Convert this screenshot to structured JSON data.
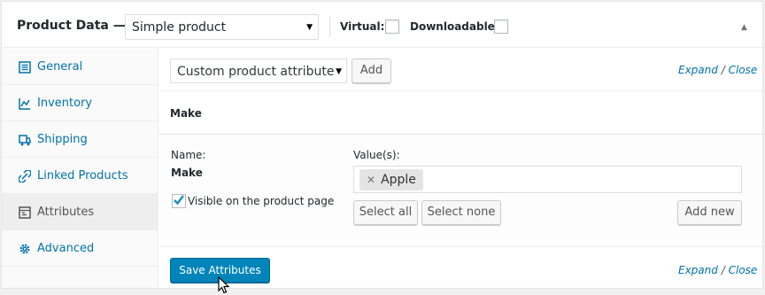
{
  "header": {
    "title": "Product Data —",
    "product_type": "Simple product",
    "virtual_label": "Virtual:",
    "downloadable_label": "Downloadable:"
  },
  "sidebar": {
    "items": [
      {
        "label": "General",
        "icon": "general-icon",
        "active": false
      },
      {
        "label": "Inventory",
        "icon": "inventory-icon",
        "active": false
      },
      {
        "label": "Shipping",
        "icon": "shipping-icon",
        "active": false
      },
      {
        "label": "Linked Products",
        "icon": "linked-products-icon",
        "active": false
      },
      {
        "label": "Attributes",
        "icon": "attributes-icon",
        "active": true
      },
      {
        "label": "Advanced",
        "icon": "gear-icon",
        "active": false
      }
    ]
  },
  "toolbar": {
    "attribute_select": "Custom product attribute",
    "add_label": "Add",
    "expand": "Expand",
    "slash": "/",
    "close": "Close"
  },
  "attribute": {
    "header_name": "Make",
    "name_label": "Name:",
    "name_value": "Make",
    "values_label": "Value(s):",
    "chip_value": "Apple",
    "visible_label": "Visible on the product page",
    "visible_checked": true,
    "select_all": "Select all",
    "select_none": "Select none",
    "add_new": "Add new"
  },
  "footer": {
    "save_label": "Save Attributes",
    "expand": "Expand",
    "slash": "/",
    "close": "Close"
  },
  "colors": {
    "link": "#0073aa",
    "primary_button": "#0085ba",
    "check": "#1e8cbe"
  }
}
